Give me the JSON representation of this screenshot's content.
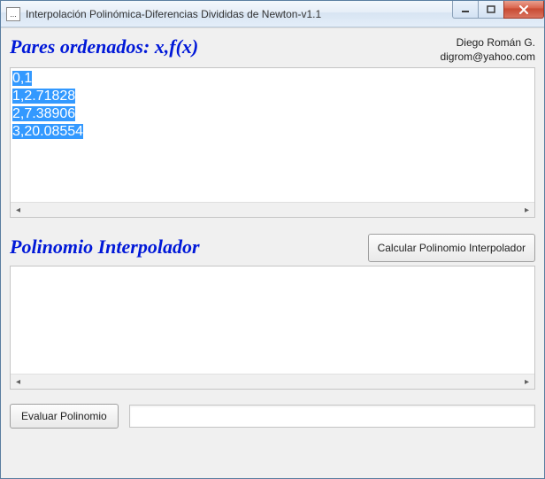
{
  "window": {
    "title": "Interpolación Polinómica-Diferencias Divididas de Newton-v1.1",
    "app_icon_text": "..."
  },
  "credits": {
    "name": "Diego Román G.",
    "email": "digrom@yahoo.com"
  },
  "section_pairs": {
    "heading": "Pares ordenados: x,f(x)",
    "lines": [
      "0,1",
      "1,2.71828",
      "2,7.38906",
      "3,20.08554"
    ]
  },
  "section_poly": {
    "heading": "Polinomio Interpolador",
    "button_label": "Calcular Polinomio Interpolador",
    "content": ""
  },
  "bottom": {
    "eval_button_label": "Evaluar Polinomio",
    "eval_value": ""
  }
}
